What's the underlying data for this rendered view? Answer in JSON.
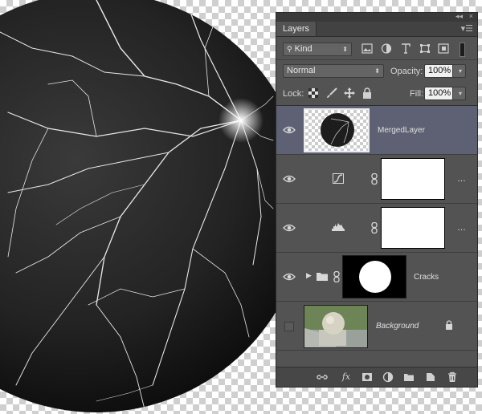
{
  "panel": {
    "tab_label": "Layers",
    "collapse_icon": "double-chevron-icon",
    "menu_icon": "panel-menu-icon"
  },
  "filter": {
    "kind_label": "Kind",
    "icons": [
      "image-filter-icon",
      "adjustment-filter-icon",
      "type-filter-icon",
      "shape-filter-icon",
      "smart-object-filter-icon",
      "filter-toggle-icon"
    ]
  },
  "blend": {
    "mode": "Normal",
    "opacity_label": "Opacity:",
    "opacity_value": "100%"
  },
  "lock": {
    "label": "Lock:",
    "fill_label": "Fill:",
    "fill_value": "100%"
  },
  "layers": [
    {
      "name": "MergedLayer",
      "selected": true,
      "visible": true
    },
    {
      "name": "",
      "type": "curves-adjustment",
      "visible": true
    },
    {
      "name": "",
      "type": "levels-adjustment",
      "visible": true
    },
    {
      "name": "Cracks",
      "type": "group",
      "visible": true
    },
    {
      "name": "Background",
      "visible": false,
      "locked": true
    }
  ],
  "footer_icons": [
    "link-layers-icon",
    "fx-icon",
    "add-mask-icon",
    "new-adjustment-icon",
    "new-group-icon",
    "new-layer-icon",
    "trash-icon"
  ],
  "fx_label": "fx"
}
